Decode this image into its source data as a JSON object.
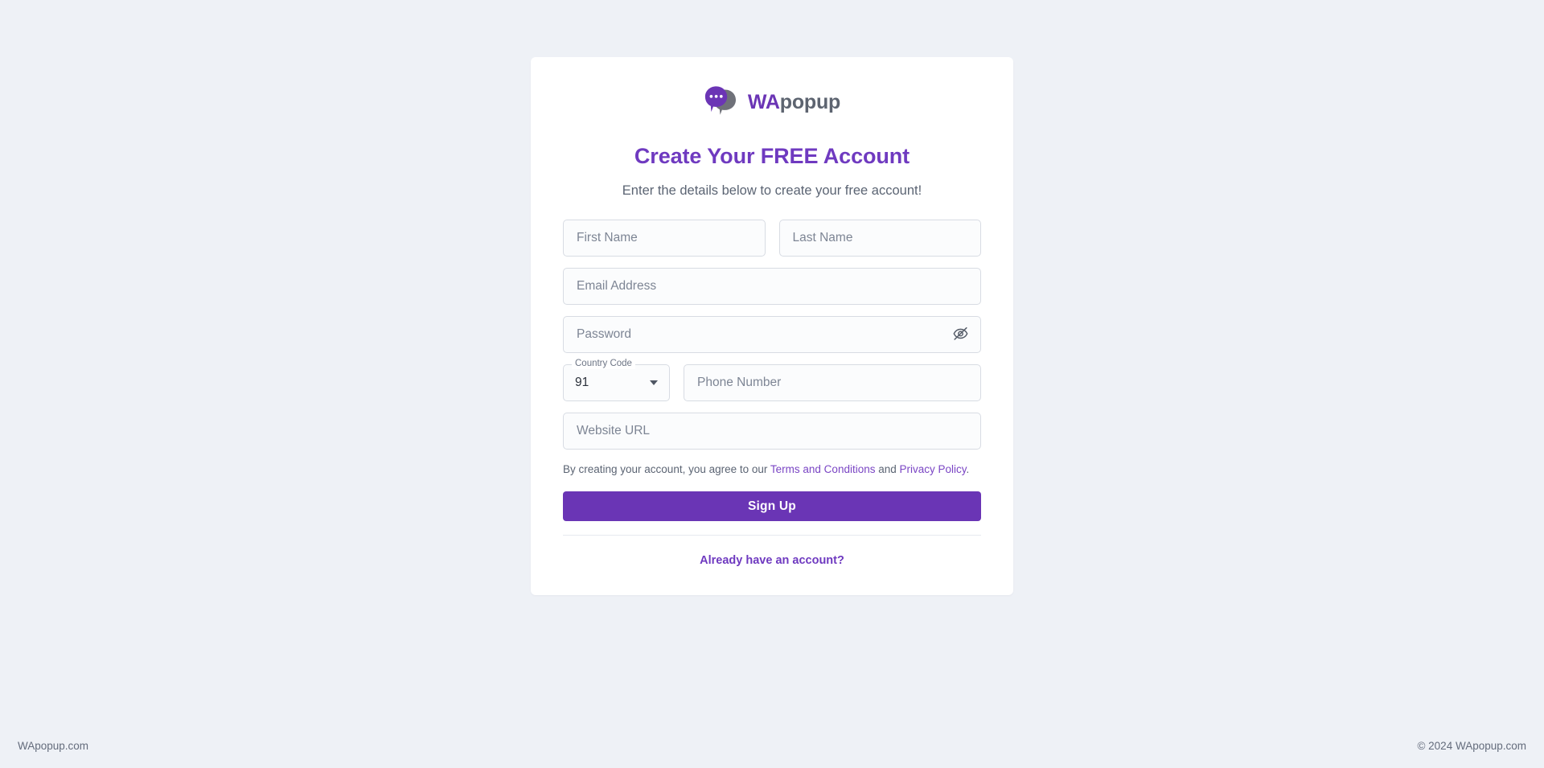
{
  "brand": {
    "logo_wa": "WA",
    "logo_popup": "popup",
    "logo_icon": "chat-bubbles-icon",
    "purple": "#6a35b5",
    "heading_purple": "#6f3ac0",
    "page_bg": "#eef1f6",
    "card_bg": "#ffffff"
  },
  "header": {
    "title": "Create Your FREE Account",
    "subtitle": "Enter the details below to create your free account!"
  },
  "form": {
    "first_name": {
      "placeholder": "First Name",
      "value": ""
    },
    "last_name": {
      "placeholder": "Last Name",
      "value": ""
    },
    "email": {
      "placeholder": "Email Address",
      "value": ""
    },
    "password": {
      "placeholder": "Password",
      "value": "",
      "toggle_icon": "eye-off-icon",
      "visible": false
    },
    "country_code": {
      "label": "Country Code",
      "value": "91",
      "caret_icon": "chevron-down-icon"
    },
    "phone": {
      "placeholder": "Phone Number",
      "value": ""
    },
    "website": {
      "placeholder": "Website URL",
      "value": ""
    }
  },
  "terms": {
    "prefix": "By creating your account, you agree to our ",
    "terms_link": "Terms and Conditions",
    "middle": " and ",
    "privacy_link": "Privacy Policy",
    "suffix": "."
  },
  "actions": {
    "signup_label": "Sign Up",
    "login_label": "Already have an account?"
  },
  "footer": {
    "left": "WApopup.com",
    "right": "© 2024 WApopup.com"
  }
}
